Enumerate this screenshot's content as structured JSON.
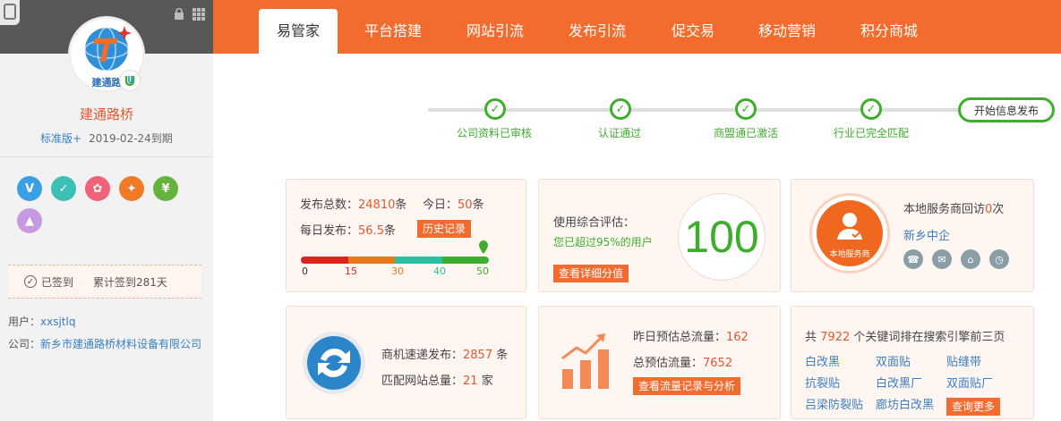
{
  "sidebar": {
    "company_name": "建通路桥",
    "logo_text": "建通路",
    "version_label": "标准版+",
    "expiry": "2019-02-24到期",
    "badges": [
      {
        "icon": "v-verified-icon",
        "glyph": "V",
        "color": "#3aa0e6"
      },
      {
        "icon": "shield-icon",
        "glyph": "✓",
        "color": "#3cc0b5"
      },
      {
        "icon": "award-icon",
        "glyph": "✿",
        "color": "#f06277"
      },
      {
        "icon": "star-badge-icon",
        "glyph": "✦",
        "color": "#f07a25"
      },
      {
        "icon": "yen-icon",
        "glyph": "¥",
        "color": "#63b33c"
      },
      {
        "icon": "image-icon",
        "glyph": "▲",
        "color": "#c59ae0"
      }
    ],
    "checkin_status": "已签到",
    "checkin_total": "累计签到281天",
    "user_label": "用户：",
    "user_value": "xxsjtlq",
    "company_label": "公司：",
    "company_value": "新乡市建通路桥材料设备有限公司"
  },
  "nav": {
    "tabs": [
      "易管家",
      "平台搭建",
      "网站引流",
      "发布引流",
      "促交易",
      "移动营销",
      "积分商城"
    ],
    "active": 0
  },
  "progress": {
    "steps": [
      "公司资料已审核",
      "认证通过",
      "商盟通已激活",
      "行业已完全匹配"
    ],
    "final_button": "开始信息发布"
  },
  "publish": {
    "total_label": "发布总数：",
    "total_value": "24810",
    "total_unit": "条",
    "today_label": "今日：",
    "today_value": "50",
    "today_unit": "条",
    "daily_label": "每日发布：",
    "daily_value": "56.5",
    "daily_unit": "条",
    "history_button": "历史记录",
    "scale": [
      "0",
      "15",
      "30",
      "40",
      "50"
    ],
    "scale_colors": [
      "#333333",
      "#d9261c",
      "#e87a1c",
      "#2bbfa6",
      "#3dae2b"
    ],
    "current": 50
  },
  "evaluation": {
    "label": "使用综合评估：",
    "exceed_text": "您已超过95%的用户",
    "button": "查看详细分值",
    "score": "100"
  },
  "service": {
    "circle_text": "本地服务商",
    "visits_prefix": "本地服务商回访",
    "visits_value": "0",
    "visits_suffix": "次",
    "provider_name": "新乡中企",
    "icons": [
      "phone-icon",
      "chat-icon",
      "home-icon",
      "clock-icon"
    ]
  },
  "quickpub": {
    "fast_label": "商机速递发布：",
    "fast_value": "2857",
    "fast_unit": "条",
    "match_label": "匹配网站总量：",
    "match_value": "21",
    "match_unit": "家"
  },
  "traffic": {
    "yesterday_label": "昨日预估总流量：",
    "yesterday_value": "162",
    "total_label": "总预估流量：",
    "total_value": "7652",
    "button": "查看流量记录与分析"
  },
  "keywords": {
    "prefix": "共",
    "count": "7922",
    "suffix": "个关键词排在搜索引擎前三页",
    "items": [
      "白改黑",
      "双面贴",
      "贴缝带",
      "抗裂贴",
      "白改黑厂",
      "双面贴厂",
      "吕梁防裂贴",
      "廊坊白改黑"
    ],
    "more_button": "查询更多"
  }
}
